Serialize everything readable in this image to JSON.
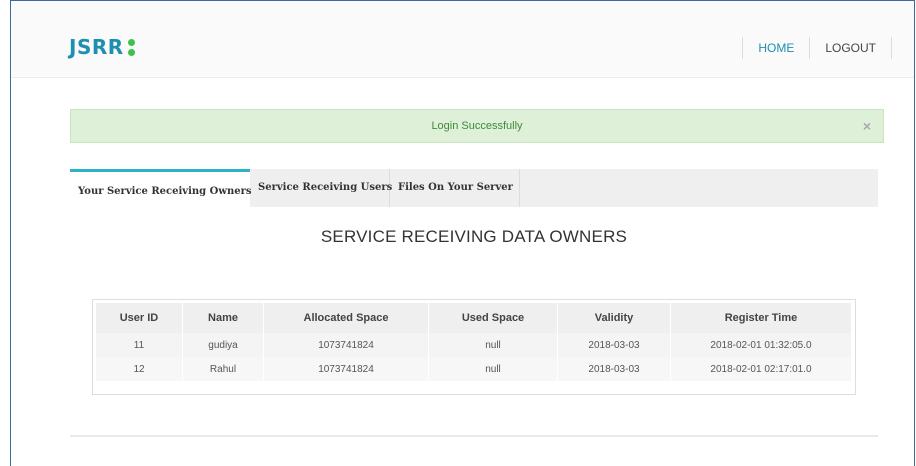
{
  "header": {
    "logo_text": "JSRR",
    "nav": [
      {
        "label": "HOME"
      },
      {
        "label": "LOGOUT"
      }
    ]
  },
  "alert": {
    "message": "Login Successfully",
    "close_glyph": "×"
  },
  "tabs": [
    {
      "label": "Your Service Receiving Owners"
    },
    {
      "label": "Service Receiving Users"
    },
    {
      "label": "Files On Your Server"
    }
  ],
  "section_title": "SERVICE RECEIVING DATA OWNERS",
  "table": {
    "headers": [
      "User ID",
      "Name",
      "Allocated Space",
      "Used Space",
      "Validity",
      "Register Time"
    ],
    "rows": [
      [
        "11",
        "gudiya",
        "1073741824",
        "null",
        "2018-03-03",
        "2018-02-01 01:32:05.0"
      ],
      [
        "12",
        "Rahul",
        "1073741824",
        "null",
        "2018-03-03",
        "2018-02-01 02:17:01.0"
      ]
    ]
  },
  "colors": {
    "brand": "#1e8fb0",
    "logo_dots": "#3cc24a",
    "active_tab_border": "#2ab3c9",
    "alert_bg": "#dff0d8"
  }
}
